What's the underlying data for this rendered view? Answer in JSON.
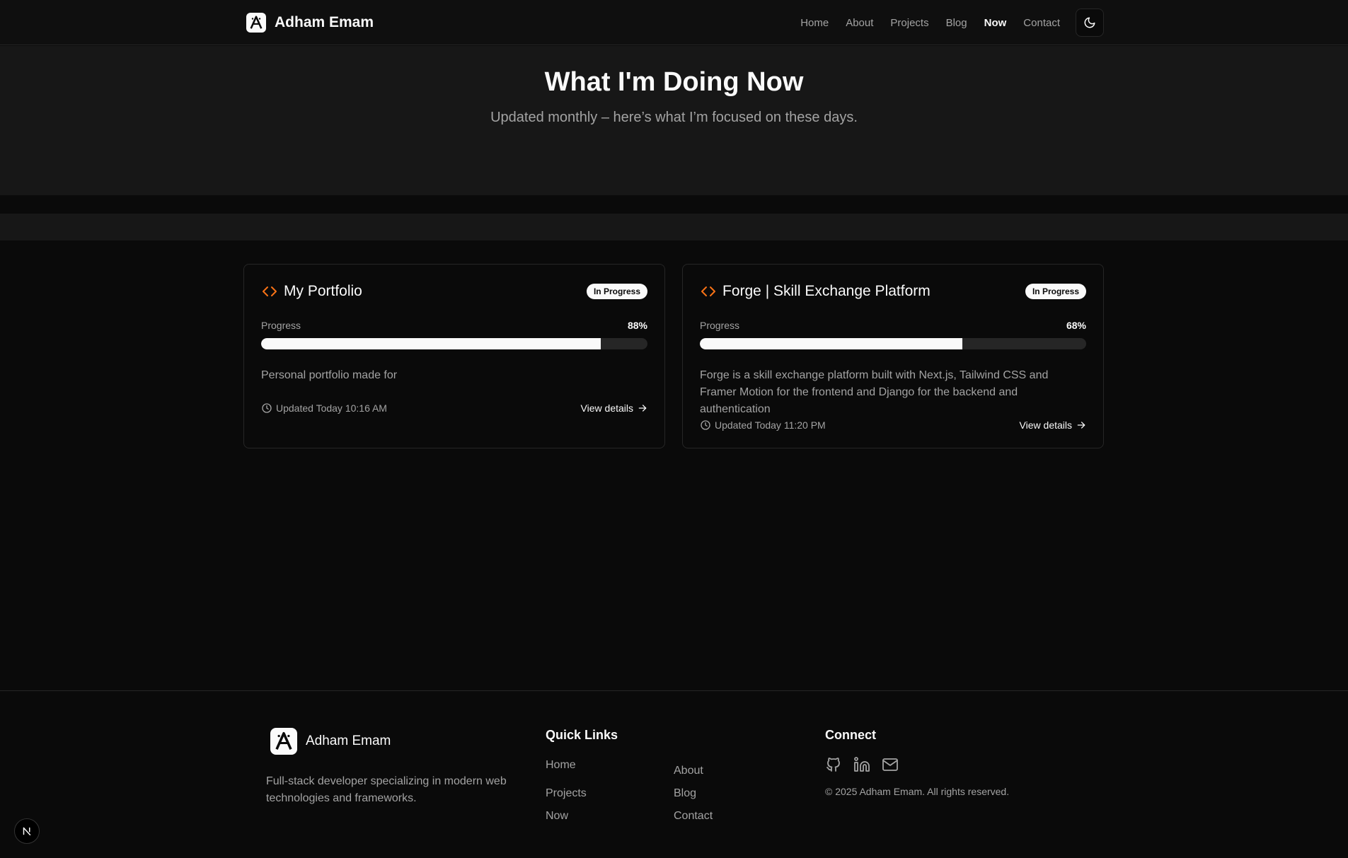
{
  "header": {
    "brand": "Adham Emam",
    "nav": [
      "Home",
      "About",
      "Projects",
      "Blog",
      "Now",
      "Contact"
    ],
    "active_nav": "Now",
    "theme_toggle_icon": "moon-icon"
  },
  "hero": {
    "title": "What I'm Doing Now",
    "subtitle": "Updated monthly – here’s what I’m focused on these days."
  },
  "projects": [
    {
      "title": "My Portfolio",
      "status": "In Progress",
      "progress_label": "Progress",
      "progress_text": "88%",
      "progress": 0.88,
      "description": "Personal portfolio made for",
      "updated": "Updated Today 10:16 AM",
      "link": "View details"
    },
    {
      "title": "Forge | Skill Exchange Platform",
      "status": "In Progress",
      "progress_label": "Progress",
      "progress_text": "68%",
      "progress": 0.68,
      "description": "Forge is a skill exchange platform built with Next.js, Tailwind CSS and Framer Motion for the frontend and Django for the backend and authentication",
      "updated": "Updated Today 11:20 PM",
      "link": "View details"
    }
  ],
  "footer": {
    "brand": "Adham Emam",
    "description": "Full-stack developer specializing in modern web technologies and frameworks.",
    "quick_links_title": "Quick Links",
    "quick_links": [
      "Home",
      "About",
      "Projects",
      "Blog",
      "Now",
      "Contact"
    ],
    "connect_title": "Connect",
    "socials": [
      "github-icon",
      "linkedin-icon",
      "mail-icon"
    ],
    "copyright": "© 2025 Adham Emam. All rights reserved."
  },
  "colors": {
    "background": "#0a0a0a",
    "surface": "#171717",
    "accent": "#f97316",
    "text": "#fafafa",
    "muted": "#a3a3a3"
  }
}
